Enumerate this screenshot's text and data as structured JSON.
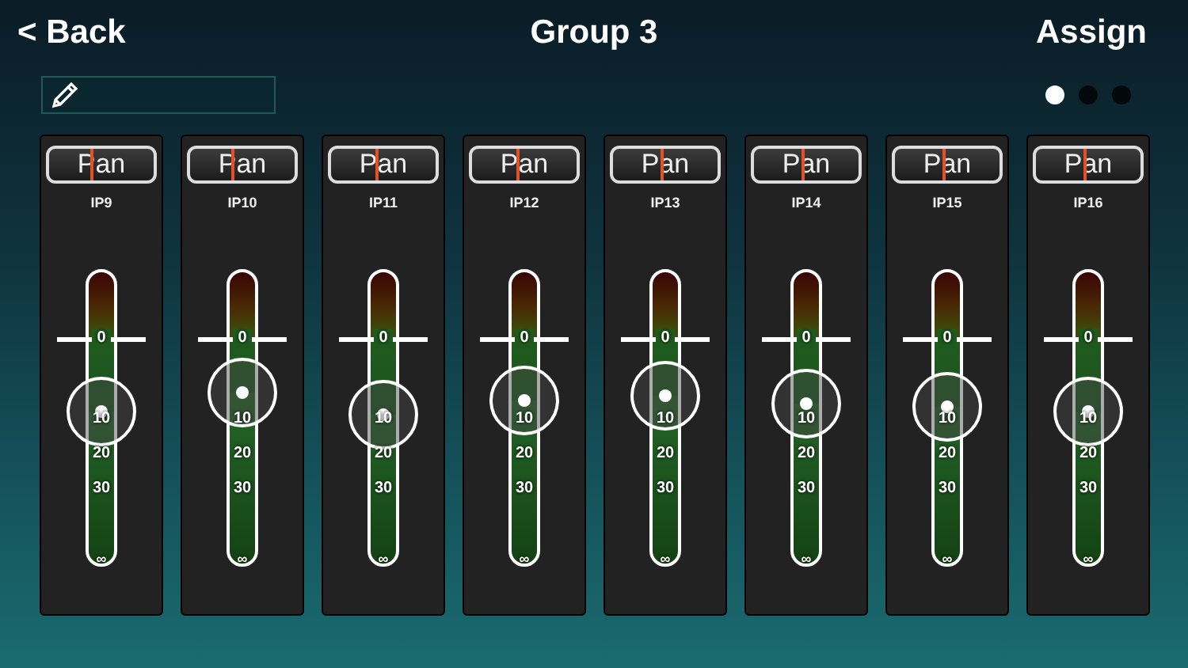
{
  "header": {
    "back": "< Back",
    "title": "Group 3",
    "action": "Assign"
  },
  "pages": [
    {
      "selected": true
    },
    {
      "selected": false
    },
    {
      "selected": false
    }
  ],
  "channels": [
    {
      "name": "IP9",
      "pan": {
        "label": "Pan",
        "level": 0.4
      },
      "level": 0.52,
      "scale": [
        "0",
        "10",
        "20",
        "30",
        "∞"
      ]
    },
    {
      "name": "IP10",
      "pan": {
        "label": "Pan",
        "level": 0.4
      },
      "level": 0.585,
      "scale": [
        "0",
        "10",
        "20",
        "30",
        "∞"
      ]
    },
    {
      "name": "IP11",
      "pan": {
        "label": "Pan",
        "level": 0.42
      },
      "level": 0.51,
      "scale": [
        "0",
        "10",
        "20",
        "30",
        "∞"
      ]
    },
    {
      "name": "IP12",
      "pan": {
        "label": "Pan",
        "level": 0.42
      },
      "level": 0.56,
      "scale": [
        "0",
        "10",
        "20",
        "30",
        "∞"
      ]
    },
    {
      "name": "IP13",
      "pan": {
        "label": "Pan",
        "level": 0.45
      },
      "level": 0.574,
      "scale": [
        "0",
        "10",
        "20",
        "30",
        "∞"
      ]
    },
    {
      "name": "IP14",
      "pan": {
        "label": "Pan",
        "level": 0.45
      },
      "level": 0.548,
      "scale": [
        "0",
        "10",
        "20",
        "30",
        "∞"
      ]
    },
    {
      "name": "IP15",
      "pan": {
        "label": "Pan",
        "level": 0.45
      },
      "level": 0.537,
      "scale": [
        "0",
        "10",
        "20",
        "30",
        "∞"
      ]
    },
    {
      "name": "IP16",
      "pan": {
        "label": "Pan",
        "level": 0.45
      },
      "level": 0.52,
      "scale": [
        "0",
        "10",
        "20",
        "30",
        "∞"
      ]
    }
  ]
}
